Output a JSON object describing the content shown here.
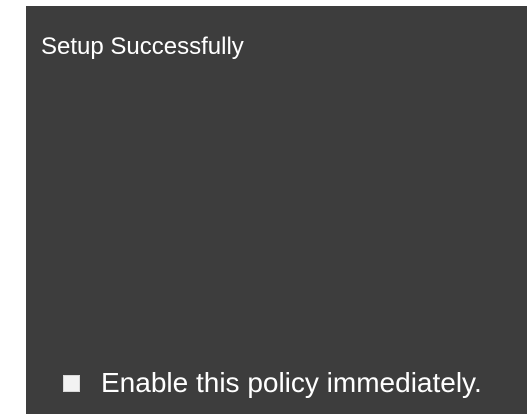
{
  "dialog": {
    "title": "Setup Successfully"
  },
  "option": {
    "label": "Enable this policy immediately.",
    "checked": false
  },
  "colors": {
    "panel_background": "#3d3d3d",
    "text": "#ffffff",
    "checkbox_fill": "#f2f2f2"
  }
}
